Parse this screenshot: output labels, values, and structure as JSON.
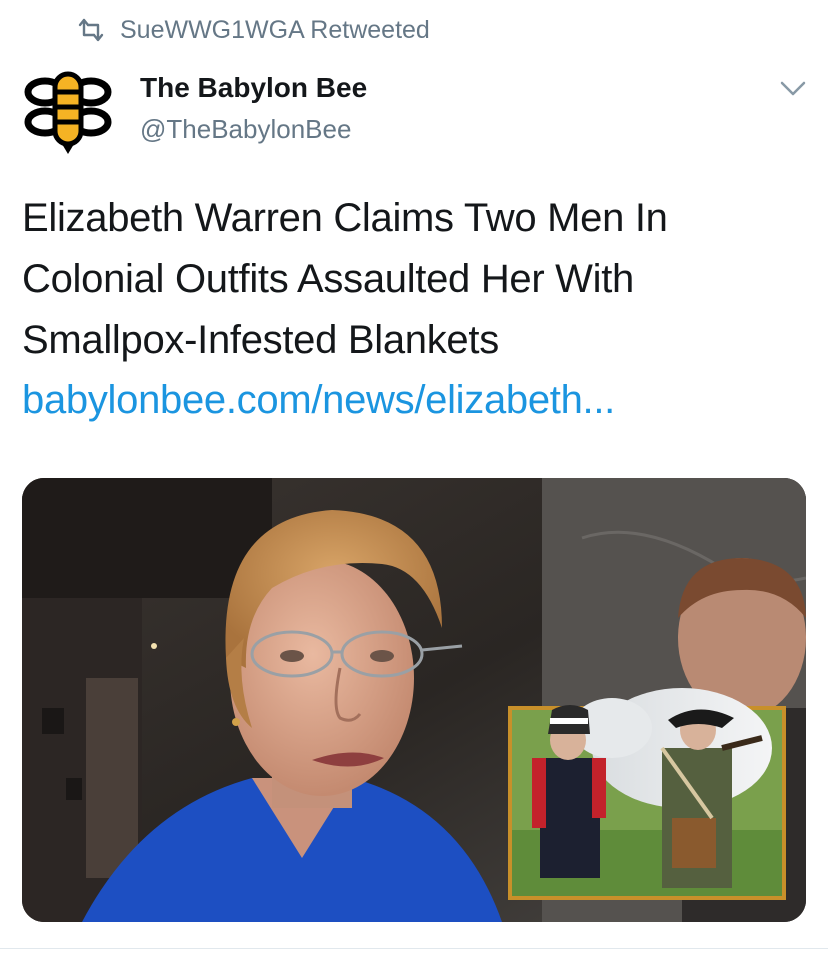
{
  "retweet": {
    "text": "SueWWG1WGA Retweeted",
    "icon": "retweet-icon"
  },
  "account": {
    "name": "The Babylon Bee",
    "handle": "@TheBabylonBee",
    "avatar_icon": "babylon-bee-logo"
  },
  "tweet": {
    "text": "Elizabeth Warren Claims Two Men In\nColonial Outfits Assaulted Her With\nSmallpox-Infested Blankets",
    "link": "babylonbee.com/news/elizabeth..."
  },
  "media": {
    "inset_border_color": "#c8902a"
  },
  "colors": {
    "link": "#1b95e0",
    "secondary_text": "#657786",
    "primary_text": "#14171a"
  }
}
